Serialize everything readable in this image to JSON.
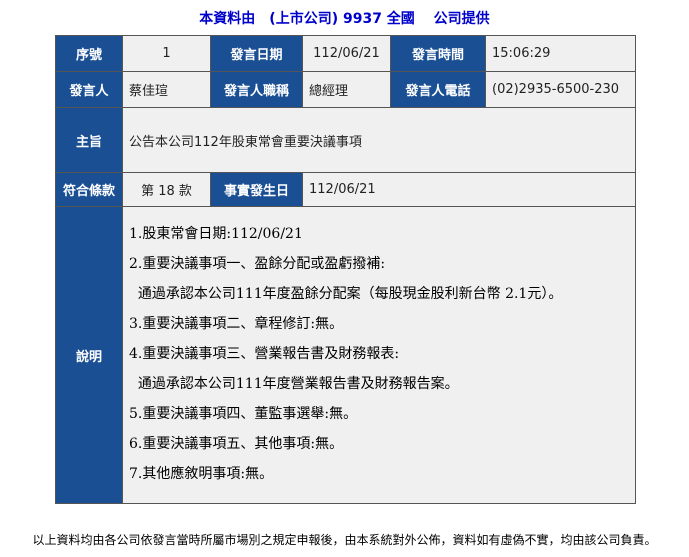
{
  "source_line": "本資料由　(上市公司) 9937 全國　 公司提供",
  "row1": {
    "seq_label": "序號",
    "seq_value": "1",
    "date_label": "發言日期",
    "date_value": "112/06/21",
    "time_label": "發言時間",
    "time_value": "15:06:29"
  },
  "row2": {
    "speaker_label": "發言人",
    "speaker_value": "蔡佳瑄",
    "title_label": "發言人職稱",
    "title_value": "總經理",
    "phone_label": "發言人電話",
    "phone_value": "(02)2935-6500-230"
  },
  "row3": {
    "subject_label": "主旨",
    "subject_value": "公告本公司112年股東常會重要決議事項"
  },
  "row4": {
    "clause_label": "符合條款",
    "clause_value": "第 18 款",
    "event_date_label": "事實發生日",
    "event_date_value": "112/06/21"
  },
  "description": {
    "label": "說明",
    "lines": [
      "1.股東常會日期:112/06/21",
      "2.重要決議事項一、盈餘分配或盈虧撥補:",
      "  通過承認本公司111年度盈餘分配案（每股現金股利新台幣 2.1元）。",
      "3.重要決議事項二、章程修訂:無。",
      "4.重要決議事項三、營業報告書及財務報表:",
      "  通過承認本公司111年度營業報告書及財務報告案。",
      "5.重要決議事項四、董監事選舉:無。",
      "6.重要決議事項五、其他事項:無。",
      "7.其他應敘明事項:無。"
    ]
  },
  "footer": "以上資料均由各公司依發言當時所屬市場別之規定申報後，由本系統對外公佈，資料如有虛偽不實，均由該公司負責。"
}
